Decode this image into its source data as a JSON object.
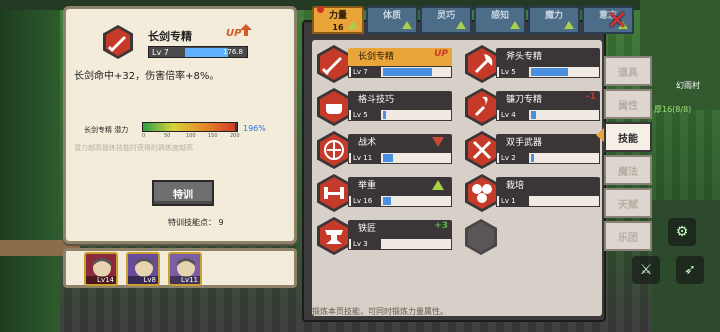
{
  "skill_detail": {
    "title": "长剑专精",
    "level_label": "Lv 7",
    "exp_value": "176.8",
    "exp_fraction": 0.72,
    "up_badge": "UP",
    "description": "长剑命中+32，伤害倍率+8%。",
    "potential_label": "长剑专精 潜力",
    "potential_ticks": [
      "0",
      "50",
      "100",
      "150",
      "200"
    ],
    "potential_percent": "196%",
    "potential_fraction": 0.98,
    "potential_note": "潜力越高锻炼技能时获得的熟练度越高",
    "train_button": "特训",
    "train_points": "特训技能点： 9"
  },
  "party": [
    {
      "level": "Lv14",
      "portrait": "gray-hair-hero-icon",
      "color": "#8a2a3a"
    },
    {
      "level": "Lv8",
      "portrait": "bat-familiar-icon",
      "color": "#6a4a9a"
    },
    {
      "level": "Lv11",
      "portrait": "blonde-hero-icon",
      "color": "#7a5fa6"
    }
  ],
  "stat_tabs": [
    {
      "label": "力量",
      "value": "16",
      "active": true
    },
    {
      "label": "体质",
      "value": "",
      "active": false
    },
    {
      "label": "灵巧",
      "value": "",
      "active": false
    },
    {
      "label": "感知",
      "value": "",
      "active": false
    },
    {
      "label": "魔力",
      "value": "",
      "active": false
    },
    {
      "label": "意志",
      "value": "",
      "active": false
    }
  ],
  "skills": [
    {
      "name": "长剑专精",
      "level": "Lv 7",
      "fill": 0.72,
      "tag": "UP",
      "tag_type": "up",
      "icon": "sword-icon",
      "selected": true
    },
    {
      "name": "斧头专精",
      "level": "Lv 5",
      "fill": 0.55,
      "tag": "",
      "tag_type": "",
      "icon": "axe-icon",
      "selected": false
    },
    {
      "name": "格斗技巧",
      "level": "Lv 5",
      "fill": 0.05,
      "tag": "",
      "tag_type": "",
      "icon": "fist-icon",
      "selected": false
    },
    {
      "name": "镰刀专精",
      "level": "Lv 4",
      "fill": 0.08,
      "tag": "-1",
      "tag_type": "minus",
      "icon": "sickle-icon",
      "selected": false
    },
    {
      "name": "战术",
      "level": "Lv 11",
      "fill": 0.15,
      "tag": "",
      "tag_type": "down",
      "icon": "tactics-icon",
      "selected": false
    },
    {
      "name": "双手武器",
      "level": "Lv 2",
      "fill": 0.04,
      "tag": "",
      "tag_type": "",
      "icon": "crossed-swords-icon",
      "selected": false
    },
    {
      "name": "举重",
      "level": "Lv 16",
      "fill": 0.12,
      "tag": "",
      "tag_type": "upgreen",
      "icon": "barbell-icon",
      "selected": false
    },
    {
      "name": "栽培",
      "level": "Lv 1",
      "fill": 0.0,
      "tag": "",
      "tag_type": "",
      "icon": "plant-icon",
      "selected": false
    },
    {
      "name": "铁匠",
      "level": "Lv 3",
      "fill": 0.0,
      "tag": "+3",
      "tag_type": "plus",
      "icon": "anvil-icon",
      "selected": false
    }
  ],
  "side_menu": [
    {
      "label": "道具",
      "active": false
    },
    {
      "label": "属性",
      "active": false
    },
    {
      "label": "技能",
      "active": true
    },
    {
      "label": "魔法",
      "active": false
    },
    {
      "label": "天赋",
      "active": false
    },
    {
      "label": "乐团",
      "active": false
    }
  ],
  "close_label": "✕",
  "footer_hint": "锻炼本页技能，可同时锻炼力量属性。",
  "map": {
    "location": "幻雨村",
    "hp": "厚16(8/8)"
  },
  "colors": {
    "accent": "#e9a53a",
    "skill_red": "#c63a2a",
    "panel": "#f3ecda",
    "dark": "#3a3637"
  }
}
